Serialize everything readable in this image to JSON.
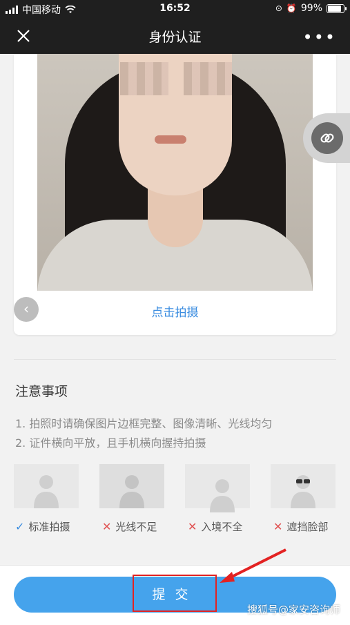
{
  "status_bar": {
    "carrier": "中国移动",
    "time": "16:52",
    "battery": "99%",
    "battery_level": 0.99
  },
  "nav": {
    "title": "身份认证",
    "more_label": "•••"
  },
  "capture": {
    "take_photo_label": "点击拍摄"
  },
  "notes": {
    "title": "注意事项",
    "lines": [
      "1. 拍照时请确保图片边框完整、图像清晰、光线均匀",
      "2. 证件横向平放，且手机横向握持拍摄"
    ]
  },
  "examples": [
    {
      "label": "标准拍摄",
      "ok": true
    },
    {
      "label": "光线不足",
      "ok": false
    },
    {
      "label": "入境不全",
      "ok": false
    },
    {
      "label": "遮挡脸部",
      "ok": false
    }
  ],
  "submit_label": "提交",
  "watermark": "搜狐号@家安咨询师",
  "colors": {
    "accent": "#45a3ec",
    "link": "#3b8de0",
    "highlight": "#e32222"
  },
  "icons": {
    "close": "close-icon",
    "link": "link-icon",
    "prev": "chevron-left-icon"
  }
}
